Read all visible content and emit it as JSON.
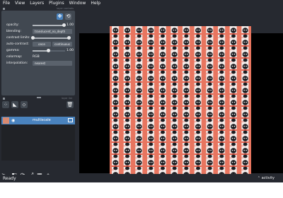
{
  "menu": [
    "File",
    "View",
    "Layers",
    "Plugins",
    "Window",
    "Help"
  ],
  "layer_controls": {
    "header_label": "layer controls",
    "opacity": {
      "label": "opacity:",
      "value": "1.00",
      "fraction": 1.0
    },
    "blending": {
      "label": "blending:",
      "value": "translucent_no_depth"
    },
    "contrast_limits": {
      "label": "contrast limits:"
    },
    "auto_contrast": {
      "label": "auto-contrast:",
      "once": "once",
      "continuous": "continuous"
    },
    "gamma": {
      "label": "gamma:",
      "value": "1.00",
      "fraction": 0.5
    },
    "colormap": {
      "label": "colormap:",
      "value": "RGB"
    },
    "interpolation": {
      "label": "interpolation:",
      "value": "nearest"
    }
  },
  "layer_list": {
    "header_label": "layer list",
    "layers": [
      {
        "name": "multiscale"
      }
    ]
  },
  "status": {
    "ready": "Ready",
    "activity": "activity"
  },
  "colors": {
    "accent": "#4a83be",
    "panel": "#414851",
    "bg": "#262930"
  }
}
